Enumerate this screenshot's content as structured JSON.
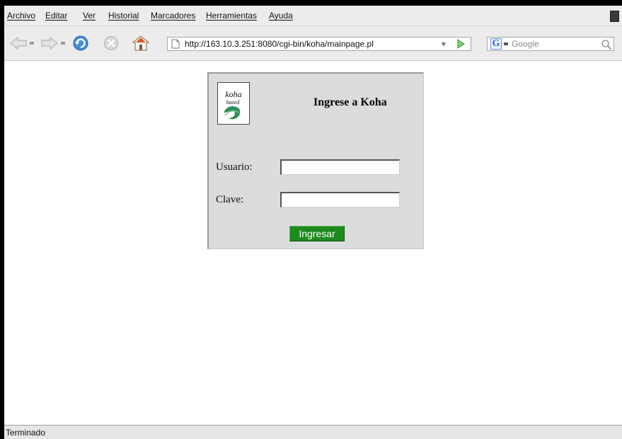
{
  "menu": {
    "items": [
      {
        "label": "Archivo"
      },
      {
        "label": "Editar"
      },
      {
        "label": "Ver"
      },
      {
        "label": "Historial"
      },
      {
        "label": "Marcadores"
      },
      {
        "label": "Herramientas"
      },
      {
        "label": "Ayuda"
      }
    ]
  },
  "toolbar": {
    "icons": {
      "back": "back-arrow-icon",
      "forward": "forward-arrow-icon",
      "reload": "reload-icon",
      "stop": "stop-icon",
      "home": "home-icon",
      "page": "page-icon",
      "go": "go-arrow-icon",
      "search": "magnifier-icon"
    },
    "url": "http://163.10.3.251:8080/cgi-bin/koha/mainpage.pl",
    "search": {
      "engine_glyph": "G",
      "placeholder": "Google"
    }
  },
  "login": {
    "logo": {
      "line1": "koha",
      "line2": "based"
    },
    "title": "Ingrese a Koha",
    "username_label": "Usuario:",
    "username_value": "",
    "password_label": "Clave:",
    "password_value": "",
    "submit_label": "Ingresar"
  },
  "status": {
    "text": "Terminado"
  },
  "colors": {
    "chrome": "#ececec",
    "panel": "#dcdcdc",
    "submit": "#1d8a1d"
  }
}
